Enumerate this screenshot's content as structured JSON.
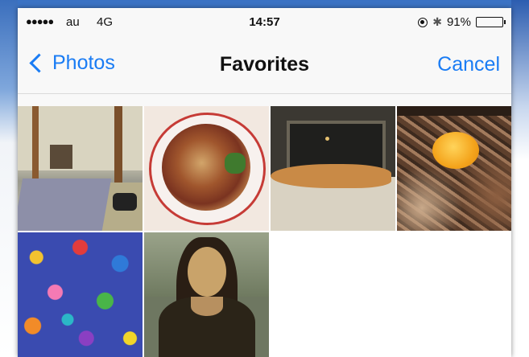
{
  "status_bar": {
    "signal": "●●●●●",
    "carrier": "au",
    "network": "4G",
    "time": "14:57",
    "battery_percent": "91%",
    "battery_level": 0.91
  },
  "nav": {
    "back_label": "Photos",
    "title": "Favorites",
    "cancel_label": "Cancel"
  },
  "colors": {
    "accent": "#1a7cf4"
  },
  "photos": [
    {
      "name": "room-with-futon"
    },
    {
      "name": "noodle-bowl"
    },
    {
      "name": "cat-on-windowsill"
    },
    {
      "name": "beef-bowl-with-egg"
    },
    {
      "name": "colorful-flowers"
    },
    {
      "name": "mona-lisa"
    }
  ]
}
